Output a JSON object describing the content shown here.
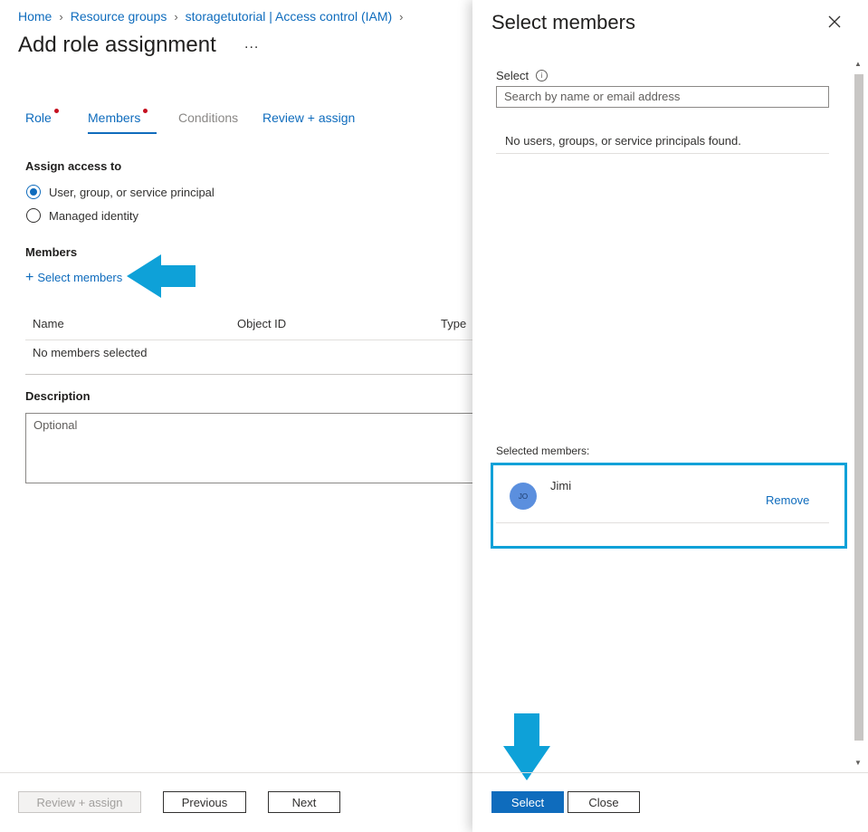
{
  "breadcrumb": [
    "Home",
    "Resource groups",
    "storagetutorial | Access control (IAM)"
  ],
  "page_title": "Add role assignment",
  "more_label": "...",
  "tabs": [
    {
      "label": "Role",
      "required": true
    },
    {
      "label": "Members",
      "required": true,
      "active": true
    },
    {
      "label": "Conditions",
      "disabled": true
    },
    {
      "label": "Review + assign"
    }
  ],
  "assign_access": {
    "label": "Assign access to",
    "options": [
      "User, group, or service principal",
      "Managed identity"
    ],
    "selected": "User, group, or service principal"
  },
  "members": {
    "label": "Members",
    "select_link": "Select members",
    "columns": [
      "Name",
      "Object ID",
      "Type"
    ],
    "empty_text": "No members selected"
  },
  "description": {
    "label": "Description",
    "placeholder": "Optional"
  },
  "footer": {
    "review_assign": "Review + assign",
    "previous": "Previous",
    "next": "Next"
  },
  "panel": {
    "title": "Select members",
    "select_label": "Select",
    "search_placeholder": "Search by name or email address",
    "no_results": "No users, groups, or service principals found.",
    "selected_label": "Selected members:",
    "selected_members": [
      {
        "initials": "JO",
        "name": "Jimi",
        "action": "Remove"
      }
    ],
    "select_button": "Select",
    "close_button": "Close"
  },
  "colors": {
    "accent": "#0f6cbd",
    "annotation_arrow": "#0ea1d8",
    "required_dot": "#c50f1f"
  }
}
